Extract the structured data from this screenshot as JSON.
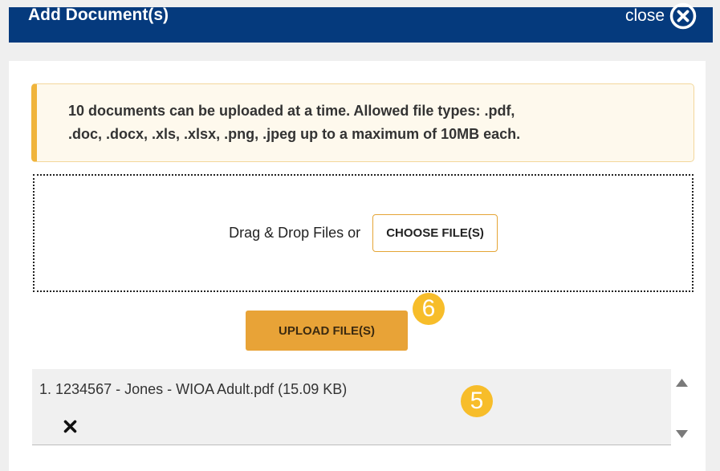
{
  "dialog": {
    "title": "Add Document(s)",
    "close_label": "close"
  },
  "notice": {
    "line1": "10 documents can be uploaded at a time. Allowed file types: .pdf,",
    "line2": ".doc, .docx, .xls, .xlsx, .png, .jpeg up to a maximum of 10MB each."
  },
  "dropzone": {
    "prompt": "Drag & Drop Files or",
    "choose_label": "CHOOSE FILE(S)"
  },
  "upload": {
    "label": "UPLOAD FILE(S)"
  },
  "badges": {
    "upload_step": "6",
    "file_step": "5"
  },
  "files": [
    {
      "label": "1. 1234567 - Jones - WIOA Adult.pdf (15.09 KB)"
    }
  ],
  "colors": {
    "header": "#053a7d",
    "accent": "#e8a337",
    "badge": "#f7bd2a",
    "notice_border": "#f0b43b"
  },
  "icons": {
    "close": "close-circle-icon",
    "remove": "x-icon",
    "scroll_up": "triangle-up-icon",
    "scroll_down": "triangle-down-icon"
  }
}
